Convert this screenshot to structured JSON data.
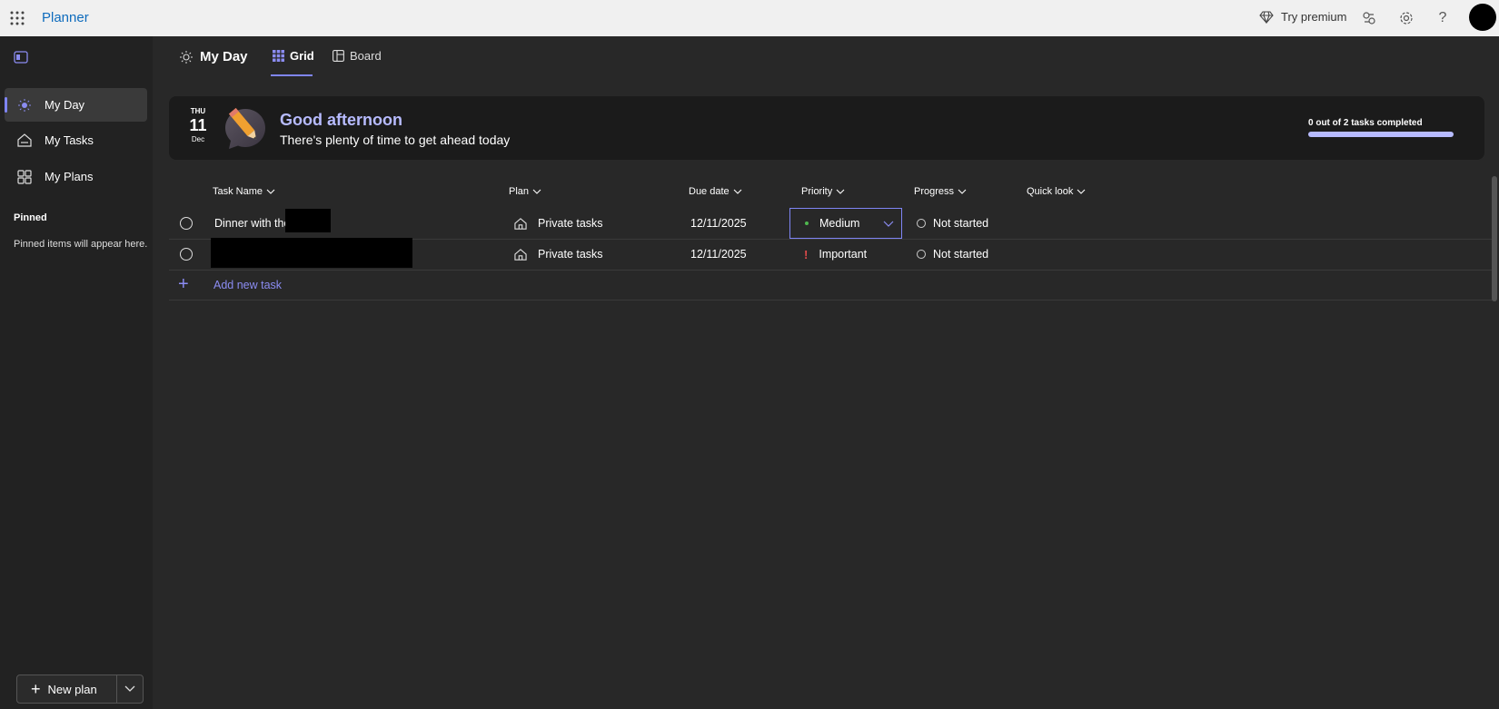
{
  "topbar": {
    "app_name": "Planner",
    "premium_label": "Try premium",
    "icons": [
      "waffle-icon",
      "diamond-icon",
      "feedback-icon",
      "gear-icon",
      "help-icon"
    ]
  },
  "sidebar": {
    "items": [
      {
        "label": "My Day",
        "icon": "sun-icon",
        "active": true
      },
      {
        "label": "My Tasks",
        "icon": "home-icon",
        "active": false
      },
      {
        "label": "My Plans",
        "icon": "grid-icon",
        "active": false
      }
    ],
    "pinned_heading": "Pinned",
    "pinned_empty": "Pinned items will appear here.",
    "new_plan_label": "New plan"
  },
  "header": {
    "title": "My Day",
    "tabs": [
      {
        "label": "Grid",
        "active": true
      },
      {
        "label": "Board",
        "active": false
      }
    ]
  },
  "banner": {
    "day_of_week": "THU",
    "day": "11",
    "month": "Dec",
    "greeting": "Good afternoon",
    "subtitle": "There's plenty of time to get ahead today",
    "progress_text": "0 out of 2 tasks completed",
    "progress_fraction": 0
  },
  "columns": [
    "Task Name",
    "Plan",
    "Due date",
    "Priority",
    "Progress",
    "Quick look"
  ],
  "tasks": [
    {
      "name": "Dinner with the",
      "plan": "Private tasks",
      "due": "12/11/2025",
      "priority": "Medium",
      "progress": "Not started"
    },
    {
      "name": "",
      "plan": "Private tasks",
      "due": "12/11/2025",
      "priority": "Important",
      "progress": "Not started"
    }
  ],
  "add_task_label": "Add new task",
  "colors": {
    "accent": "#7f85f5",
    "greeting": "#b7bbff",
    "medium_dot": "#4fb84f",
    "important": "#e04b4b"
  }
}
